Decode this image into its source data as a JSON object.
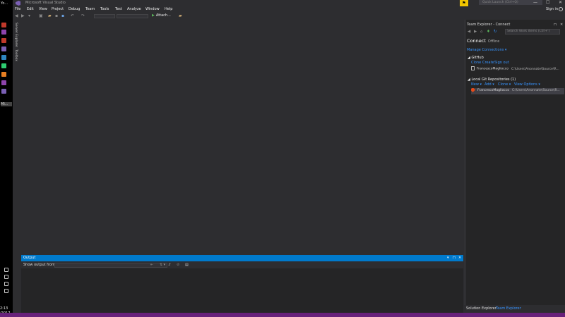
{
  "taskbar": {
    "top_app_label": "Yo...",
    "active_app_label": "Mi...",
    "time": "2:13",
    "date": "/2017",
    "app_icon_colors": [
      "#8e44ad",
      "#c0392b",
      "#8e44ad",
      "#c0392b",
      "#7a5fb4",
      "#2e86c1",
      "#2ecc71",
      "#e67e22",
      "#8e44ad",
      "#7a5fb4",
      "#2980b9"
    ]
  },
  "titlebar": {
    "app_title": "Microsoft Visual Studio",
    "quick_launch_placeholder": "Quick Launch (Ctrl+Q)",
    "minimize": "—",
    "maximize": "☐",
    "close": "✕",
    "notification": "⚑"
  },
  "menubar": {
    "items": [
      "File",
      "Edit",
      "View",
      "Project",
      "Debug",
      "Team",
      "Tools",
      "Test",
      "Analyze",
      "Window",
      "Help"
    ],
    "signin": "Sign in"
  },
  "toolbar": {
    "attach_label": "Attach...",
    "attach_icon": "▶"
  },
  "left_tabs": {
    "server_explorer": "Server Explorer",
    "toolbox": "Toolbox"
  },
  "output": {
    "title": "Output",
    "show_output_from": "Show output from:",
    "source_value": "",
    "header_buttons": [
      "▾",
      "⊓",
      "✕"
    ]
  },
  "team_explorer": {
    "title": "Team Explorer - Connect",
    "search_placeholder": "Search Work Items (Ctrl+')",
    "connect_heading": "Connect",
    "offline_label": "Offline",
    "manage_connections": "Manage Connections ▾",
    "github": {
      "section_title": "GitHub",
      "links": [
        "Clone",
        "Create",
        "Sign out"
      ],
      "repo_name": "FrancescoMagliocco",
      "repo_path": "C:\\Users\\Anonnate\\Source\\R..."
    },
    "local_git": {
      "section_title": "Local Git Repositories (1)",
      "links": [
        "New ▾",
        "Add ▾",
        "Clone ▾",
        "View Options ▾"
      ],
      "repo_name": "FrancescoMagliocco",
      "repo_path": "C:\\Users\\Anonnate\\Source\\R..."
    }
  },
  "right_tabs": {
    "solution_explorer": "Solution Explorer",
    "team_explorer": "Team Explorer"
  },
  "colors": {
    "accent": "#007acc",
    "status_bar": "#68217a",
    "link": "#3794ff"
  }
}
